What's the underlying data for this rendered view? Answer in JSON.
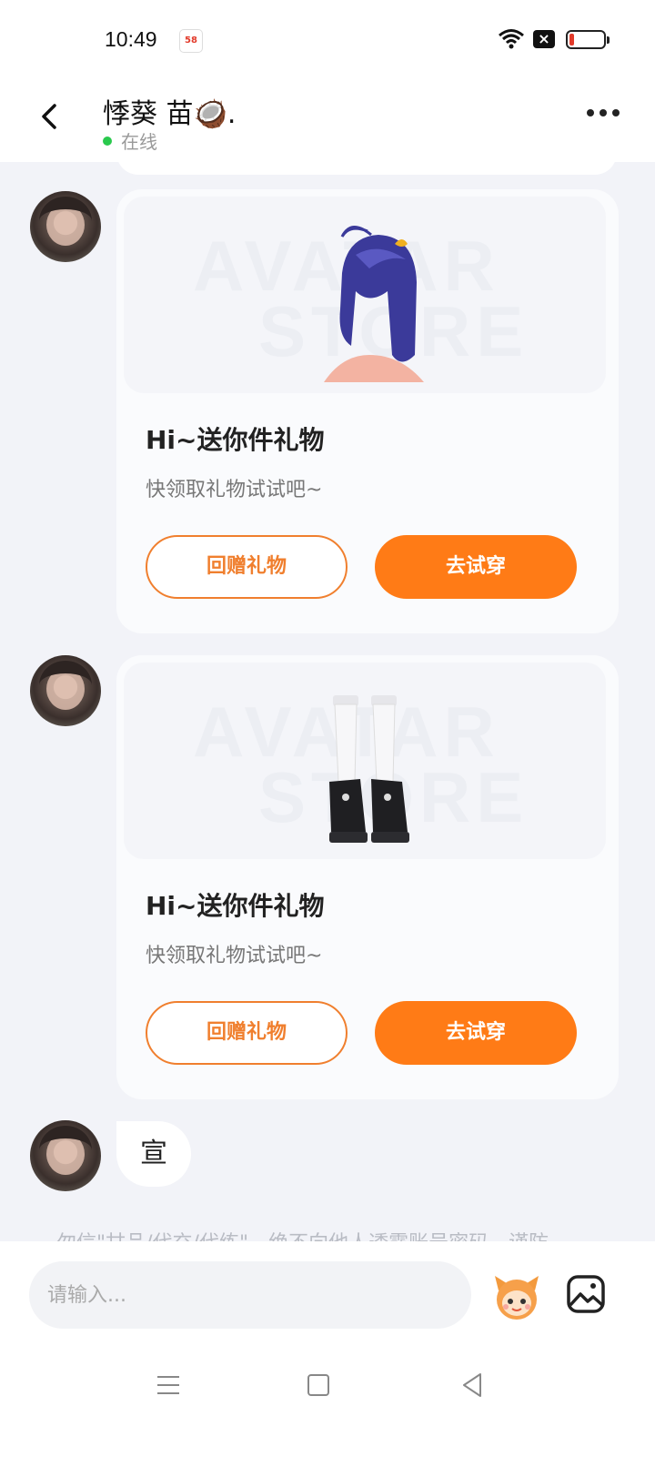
{
  "status_bar": {
    "time": "10:49",
    "app_badge": "58"
  },
  "header": {
    "chat_name": "悸葵 苗🥥.",
    "status": "在线"
  },
  "messages": [
    {
      "type": "gift",
      "item_icon": "anime-hair-icon",
      "watermark_line1": "AVATAR",
      "watermark_line2": "STORE",
      "title": "Hi~送你件礼物",
      "subtitle": "快领取礼物试试吧~",
      "return_gift_label": "回赠礼物",
      "try_on_label": "去试穿"
    },
    {
      "type": "gift",
      "item_icon": "socks-shoes-icon",
      "watermark_line1": "AVATAR",
      "watermark_line2": "STORE",
      "title": "Hi~送你件礼物",
      "subtitle": "快领取礼物试试吧~",
      "return_gift_label": "回赠礼物",
      "try_on_label": "去试穿"
    },
    {
      "type": "text",
      "text": "宣"
    }
  ],
  "notice": "勿信\"甘品/代充/代练\"，绝不向他人透露账号密码，谨防",
  "composer": {
    "placeholder": "请输入..."
  },
  "colors": {
    "accent": "#ff7b16",
    "online": "#2ac94d"
  }
}
